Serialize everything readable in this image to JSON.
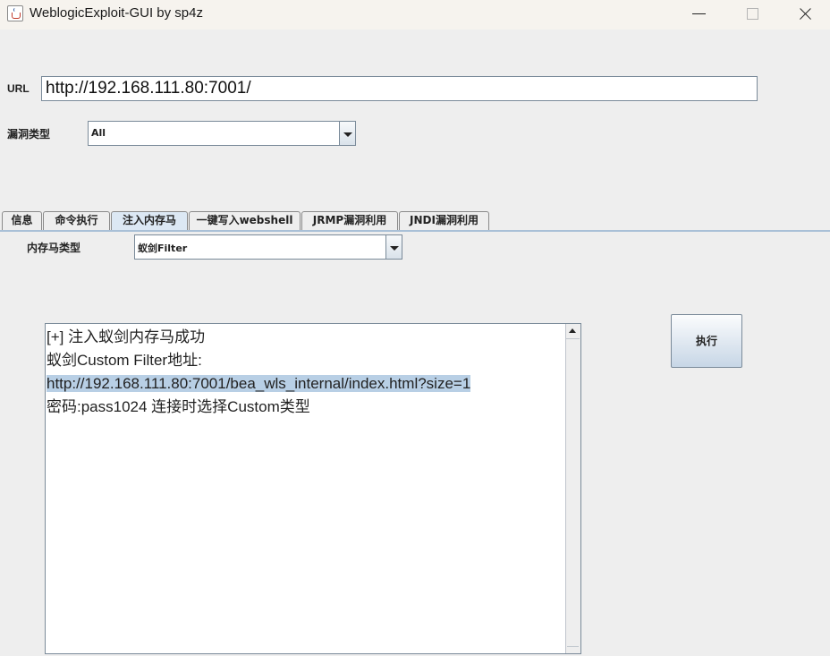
{
  "window": {
    "title": "WeblogicExploit-GUI by sp4z",
    "icon": "java-icon"
  },
  "form": {
    "url_label": "URL",
    "url_value": "http://192.168.111.80:7001/",
    "vuln_type_label": "漏洞类型",
    "vuln_type_selected": "All"
  },
  "tabs": [
    {
      "label": "信息",
      "active": false
    },
    {
      "label": "命令执行",
      "active": false
    },
    {
      "label": "注入内存马",
      "active": true
    },
    {
      "label": "一键写入webshell",
      "active": false
    },
    {
      "label": "JRMP漏洞利用",
      "active": false
    },
    {
      "label": "JNDI漏洞利用",
      "active": false
    }
  ],
  "memshell": {
    "type_label": "内存马类型",
    "type_selected": "蚁剑Filter",
    "execute_label": "执行"
  },
  "output": {
    "lines": [
      "[+] 注入蚁剑内存马成功",
      "蚁剑Custom Filter地址:",
      "http://192.168.111.80:7001/bea_wls_internal/index.html?size=1",
      "密码:pass1024 连接时选择Custom类型"
    ],
    "selected_line": 2
  },
  "colors": {
    "background": "#eeeeee",
    "selection": "#b8cfe5",
    "active_tab": "#dce8f4"
  }
}
